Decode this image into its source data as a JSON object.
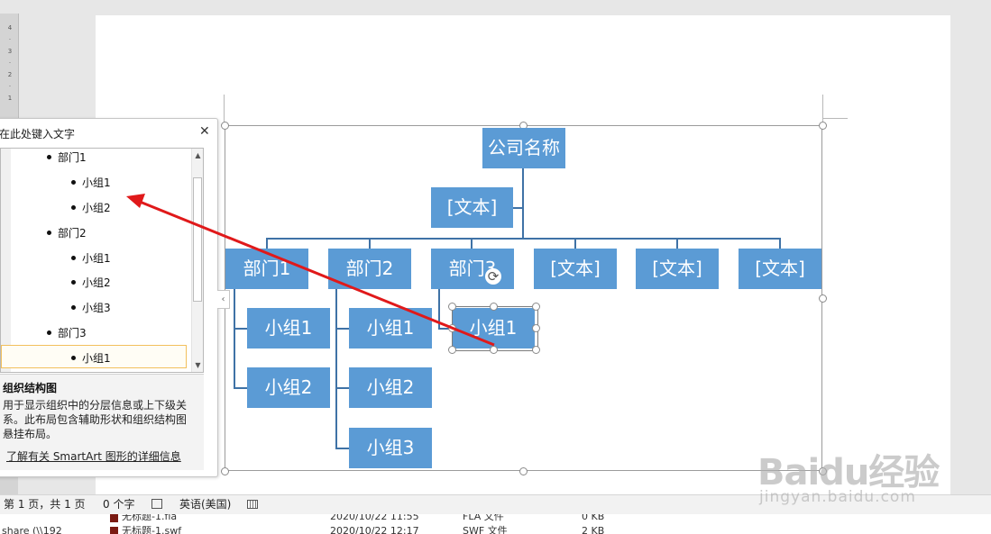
{
  "ruler": {
    "marks": [
      "4",
      "3",
      "2",
      "1"
    ]
  },
  "text_pane": {
    "title": "在此处键入文字",
    "close_icon": "✕",
    "items": [
      {
        "label": "部门1",
        "level": 1
      },
      {
        "label": "小组1",
        "level": 2
      },
      {
        "label": "小组2",
        "level": 2
      },
      {
        "label": "部门2",
        "level": 1
      },
      {
        "label": "小组1",
        "level": 2
      },
      {
        "label": "小组2",
        "level": 2
      },
      {
        "label": "小组3",
        "level": 2
      },
      {
        "label": "部门3",
        "level": 1
      },
      {
        "label": "小组1",
        "level": 2
      }
    ],
    "scroll_up_icon": "▲",
    "scroll_down_icon": "▼",
    "description_title": "组织结构图",
    "description_text": "用于显示组织中的分层信息或上下级关系。此布局包含辅助形状和组织结构图悬挂布局。",
    "learn_more_link": "了解有关 SmartArt 图形的详细信息",
    "expander_icon": "‹"
  },
  "smartart": {
    "root": "公司名称",
    "assistant": "[文本]",
    "departments": [
      "部门1",
      "部门2",
      "部门3",
      "[文本]",
      "[文本]",
      "[文本]"
    ],
    "groups_dept1": [
      "小组1",
      "小组2"
    ],
    "groups_dept2": [
      "小组1",
      "小组2",
      "小组3"
    ],
    "groups_dept3": [
      "小组1"
    ],
    "node_color": "#5b9bd5",
    "connector_color": "#3f72a6"
  },
  "annotation": {
    "arrow_color": "#e0191a"
  },
  "status_bar": {
    "page_info": "第 1 页，共 1 页",
    "word_count": "0 个字",
    "proofing_icon": "proofing-icon",
    "language": "英语(美国)",
    "layout_icon": "layout-icon"
  },
  "explorer": {
    "row1": {
      "name": "无标题-1.fla",
      "date": "2020/10/22 11:55",
      "type": "FLA 文件",
      "size": "0 KB"
    },
    "row2": {
      "name": "无标题-1.swf",
      "date": "2020/10/22 12:17",
      "type": "SWF 文件",
      "size": "2 KB"
    },
    "share": "share (\\\\192"
  },
  "watermark": {
    "main": "Baidu经验",
    "sub": "jingyan.baidu.com"
  }
}
